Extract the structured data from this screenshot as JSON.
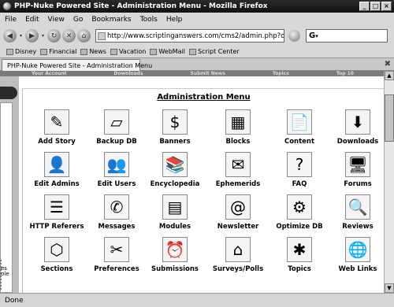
{
  "window": {
    "title": "PHP-Nuke Powered Site - Administration Menu - Mozilla Firefox"
  },
  "menubar": {
    "items": [
      "File",
      "Edit",
      "View",
      "Go",
      "Bookmarks",
      "Tools",
      "Help"
    ]
  },
  "navigation": {
    "url": "http://www.scriptinganswers.com/cms2/admin.php?op=mod_auth",
    "search_engine_icon": "G"
  },
  "bookmarks": [
    "Disney",
    "Financial",
    "News",
    "Vacation",
    "WebMail",
    "Script Center"
  ],
  "tab": {
    "title": "PHP-Nuke Powered Site - Administration Menu"
  },
  "site_nav": [
    "Your Account",
    "Downloads",
    "Submit News",
    "Topics",
    "Top 10"
  ],
  "left_fragment": {
    "line1": "es",
    "line2": "ole"
  },
  "admin": {
    "heading": "Administration Menu",
    "items": [
      {
        "label": "Add Story",
        "icon": "✎"
      },
      {
        "label": "Backup DB",
        "icon": "▱"
      },
      {
        "label": "Banners",
        "icon": "$"
      },
      {
        "label": "Blocks",
        "icon": "▦"
      },
      {
        "label": "Content",
        "icon": "📄"
      },
      {
        "label": "Downloads",
        "icon": "⬇"
      },
      {
        "label": "Edit Admins",
        "icon": "👤"
      },
      {
        "label": "Edit Users",
        "icon": "👥"
      },
      {
        "label": "Encyclopedia",
        "icon": "📚"
      },
      {
        "label": "Ephemerids",
        "icon": "✉"
      },
      {
        "label": "FAQ",
        "icon": "?"
      },
      {
        "label": "Forums",
        "icon": "🖥"
      },
      {
        "label": "HTTP Referers",
        "icon": "☰"
      },
      {
        "label": "Messages",
        "icon": "✆"
      },
      {
        "label": "Modules",
        "icon": "▤"
      },
      {
        "label": "Newsletter",
        "icon": "@"
      },
      {
        "label": "Optimize DB",
        "icon": "⚙"
      },
      {
        "label": "Reviews",
        "icon": "🔍"
      },
      {
        "label": "Sections",
        "icon": "⬡"
      },
      {
        "label": "Preferences",
        "icon": "✂"
      },
      {
        "label": "Submissions",
        "icon": "⏰"
      },
      {
        "label": "Surveys/Polls",
        "icon": "⌂"
      },
      {
        "label": "Topics",
        "icon": "✱"
      },
      {
        "label": "Web Links",
        "icon": "🌐"
      }
    ]
  },
  "status": {
    "text": "Done"
  }
}
